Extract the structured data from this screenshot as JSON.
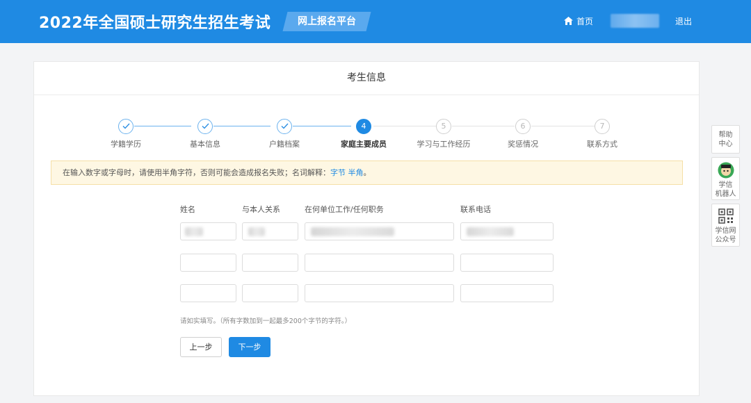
{
  "header": {
    "title": "2022年全国硕士研究生招生考试",
    "platform": "网上报名平台",
    "home": "首页",
    "logout": "退出"
  },
  "card": {
    "title": "考生信息"
  },
  "steps": [
    {
      "label": "学籍学历",
      "status": "done"
    },
    {
      "label": "基本信息",
      "status": "done"
    },
    {
      "label": "户籍档案",
      "status": "done"
    },
    {
      "label": "家庭主要成员",
      "status": "current",
      "number": "4"
    },
    {
      "label": "学习与工作经历",
      "status": "todo",
      "number": "5"
    },
    {
      "label": "奖惩情况",
      "status": "todo",
      "number": "6"
    },
    {
      "label": "联系方式",
      "status": "todo",
      "number": "7"
    }
  ],
  "notice": {
    "text": "在输入数字或字母时，请使用半角字符，否则可能会造成报名失败；名词解释：",
    "link1": "字节",
    "link2": "半角",
    "end": "。"
  },
  "form": {
    "columns": [
      "姓名",
      "与本人关系",
      "在何单位工作/任何职务",
      "联系电话"
    ],
    "hint": "请如实填写。（所有字数加到一起最多200个字节的字符。）",
    "prev": "上一步",
    "next": "下一步"
  },
  "side": {
    "help": [
      "帮助",
      "中心"
    ],
    "robot": [
      "学信",
      "机器人"
    ],
    "wechat": [
      "学信网",
      "公众号"
    ]
  },
  "colors": {
    "primary": "#1f8ae3",
    "notice_bg": "#fef7e3"
  }
}
